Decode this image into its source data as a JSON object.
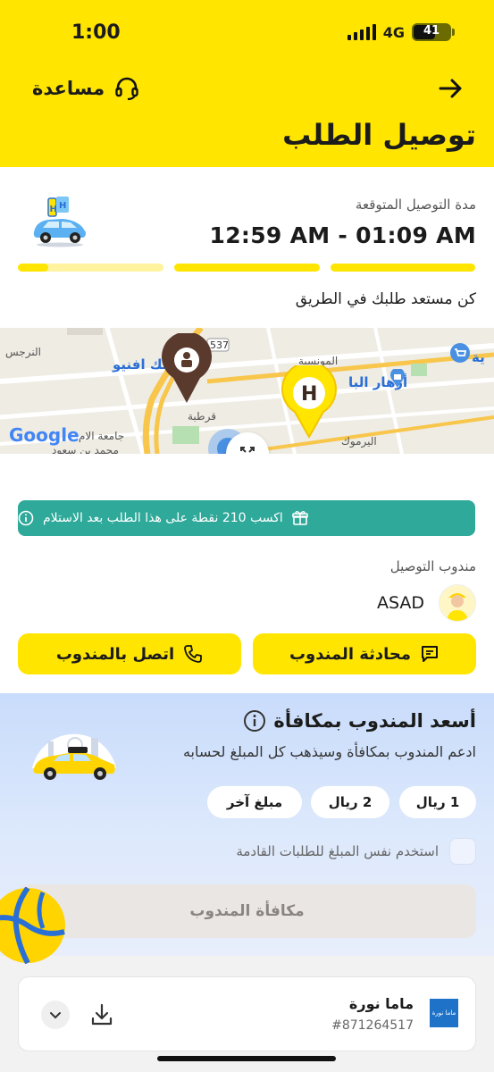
{
  "status_bar": {
    "time": "1:00",
    "network": "4G",
    "battery": "41"
  },
  "header": {
    "help_label": "مساعدة",
    "title": "توصيل الطلب"
  },
  "delivery": {
    "eta_label": "مدة التوصيل المتوقعة",
    "eta_value": "12:59 AM - 01:09 AM",
    "progress_fraction": 0.2,
    "status_message": "كن مستعد طلبك في الطريق"
  },
  "map": {
    "labels": [
      "النرجس",
      "سك افنيو",
      "537",
      "المونسية",
      "أزهار البا",
      "قرطبة",
      "اليرموك",
      "جامعة الام",
      "محمد بن سعود",
      "ية"
    ],
    "attribution": "Google"
  },
  "points_banner": {
    "text": "اكسب 210 نقطة على هذا الطلب بعد الاستلام"
  },
  "courier": {
    "label": "مندوب التوصيل",
    "name": "ASAD",
    "chat_label": "محادثة المندوب",
    "call_label": "اتصل بالمندوب"
  },
  "tip": {
    "title": "أسعد المندوب بمكافأة",
    "subtitle": "ادعم المندوب بمكافأة وسيذهب كل المبلغ لحسابه",
    "options": [
      "1 ريال",
      "2 ريال",
      "مبلغ آخر"
    ],
    "reuse_label": "استخدم نفس المبلغ للطلبات القادمة",
    "reuse_checked": false,
    "button_label": "مكافأة المندوب"
  },
  "order": {
    "store_name": "ماما نورة",
    "order_number": "#871264517",
    "store_logo_text": "ماما نورة"
  },
  "colors": {
    "brand_yellow": "#ffe500",
    "teal": "#2ea99a",
    "marker_brown": "#5b3a2e"
  }
}
